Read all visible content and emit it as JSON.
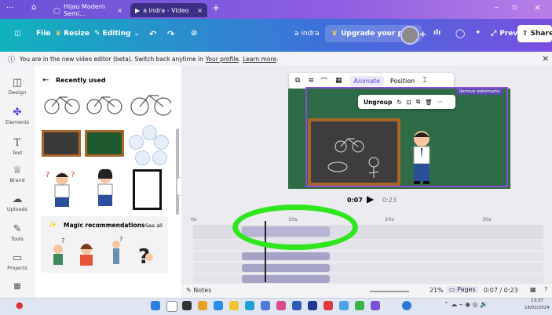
{
  "browser": {
    "tabs": [
      {
        "label": "Hijau Modern Semi..."
      },
      {
        "label": "a indra - Video"
      }
    ]
  },
  "toolbar": {
    "file": "File",
    "resize": "Resize",
    "editing": "Editing",
    "user": "a indra",
    "upgrade": "Upgrade your plan",
    "preview": "Preview",
    "share": "Share"
  },
  "banner": {
    "text": "You are in the new video editor (beta). Switch back anytime in",
    "link1": "Your profile",
    "link2": "Learn more"
  },
  "rail": [
    {
      "label": "Design",
      "icon": "layout-icon"
    },
    {
      "label": "Elements",
      "icon": "elements-icon"
    },
    {
      "label": "Text",
      "icon": "text-icon"
    },
    {
      "label": "Brand",
      "icon": "brand-icon"
    },
    {
      "label": "Uploads",
      "icon": "upload-icon"
    },
    {
      "label": "Tools",
      "icon": "tools-icon"
    },
    {
      "label": "Projects",
      "icon": "folder-icon"
    }
  ],
  "panel": {
    "title": "Recently used",
    "magic": "Magic recommendations",
    "see_all": "See all"
  },
  "context_toolbar": {
    "animate": "Animate",
    "position": "Position"
  },
  "element_toolbar": {
    "ungroup": "Ungroup"
  },
  "canvas": {
    "watermark": "Remove watermarks"
  },
  "player": {
    "current": "0:07",
    "total": "0:23"
  },
  "timeline": {
    "ticks": [
      "0s",
      "10s",
      "20s",
      "30s"
    ]
  },
  "status": {
    "notes": "Notes",
    "zoom": "21%",
    "pages": "Pages",
    "page_time": "0:07 / 0:23"
  },
  "taskbar": {
    "time": "13:37",
    "date": "16/02/2024"
  },
  "colors": {
    "highlight": "#2fe61f",
    "chalkboard": "#3d3d3d",
    "frame": "#a9662a",
    "slide_bg": "#2f6b46",
    "selection": "#8a4fd6"
  }
}
